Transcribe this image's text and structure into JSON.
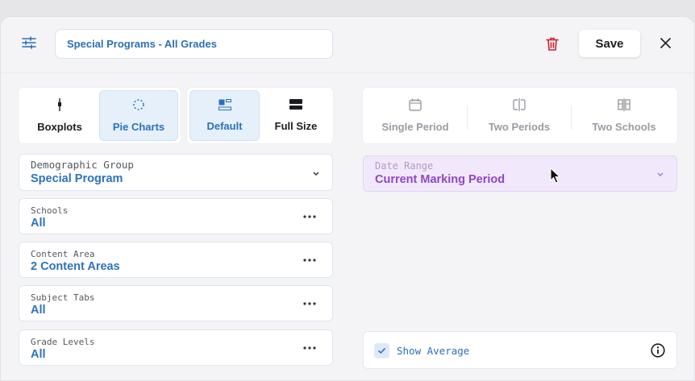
{
  "header": {
    "title_value": "Special Programs - All Grades",
    "save_label": "Save"
  },
  "chart_type_toggle": [
    {
      "label": "Boxplots",
      "icon": "boxplot-icon",
      "selected": false
    },
    {
      "label": "Pie Charts",
      "icon": "pie-chart-icon",
      "selected": true
    }
  ],
  "size_toggle": [
    {
      "label": "Default",
      "icon": "default-size-icon",
      "selected": true
    },
    {
      "label": "Full Size",
      "icon": "full-size-icon",
      "selected": false
    }
  ],
  "period_toggle": [
    {
      "label": "Single Period",
      "icon": "calendar-icon"
    },
    {
      "label": "Two Periods",
      "icon": "split-period-icon"
    },
    {
      "label": "Two Schools",
      "icon": "split-school-icon"
    }
  ],
  "fields": {
    "demographic": {
      "label": "Demographic Group",
      "value": "Special Program"
    },
    "schools": {
      "label": "Schools",
      "value": "All"
    },
    "content_area": {
      "label": "Content Area",
      "value": "2 Content Areas"
    },
    "subject_tabs": {
      "label": "Subject Tabs",
      "value": "All"
    },
    "grade_levels": {
      "label": "Grade Levels",
      "value": "All"
    }
  },
  "date_range": {
    "label": "Date Range",
    "value": "Current Marking Period"
  },
  "show_average": {
    "label": "Show Average",
    "checked": true
  },
  "colors": {
    "accent_blue": "#2c72bf",
    "selected_bg": "#e5f0fb",
    "purple": "#8e47c3",
    "delete_red": "#d1202f"
  }
}
